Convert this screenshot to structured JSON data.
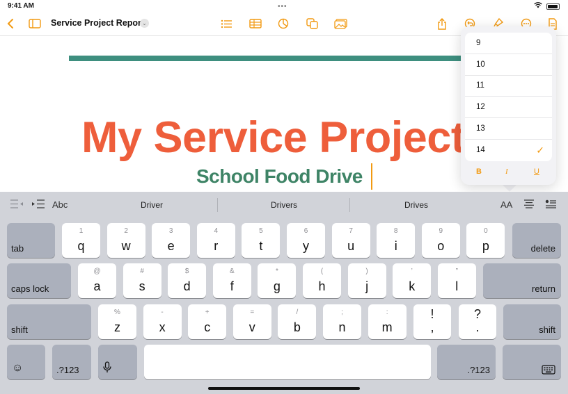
{
  "status": {
    "time": "9:41 AM",
    "dots": "•••"
  },
  "toolbar": {
    "back_icon": "chevron-left-icon",
    "title": "Service Project Report",
    "title_chevron": "⌄"
  },
  "document": {
    "heading": "My Service Project",
    "subheading": "School Food Drive"
  },
  "font_size_popover": {
    "sizes": [
      "9",
      "10",
      "11",
      "12",
      "13",
      "14"
    ],
    "selected": "14",
    "check": "✓",
    "bold": "B",
    "italic": "I",
    "underline": "U"
  },
  "keyboard": {
    "suggestions": {
      "tool_abc": "Abc",
      "word1": "Driver",
      "word2": "Drivers",
      "word3": "Drives",
      "text_size": "AA"
    },
    "row1": [
      {
        "main": "q",
        "alt": "1"
      },
      {
        "main": "w",
        "alt": "2"
      },
      {
        "main": "e",
        "alt": "3"
      },
      {
        "main": "r",
        "alt": "4"
      },
      {
        "main": "t",
        "alt": "5"
      },
      {
        "main": "y",
        "alt": "6"
      },
      {
        "main": "u",
        "alt": "7"
      },
      {
        "main": "i",
        "alt": "8"
      },
      {
        "main": "o",
        "alt": "9"
      },
      {
        "main": "p",
        "alt": "0"
      }
    ],
    "row2": [
      {
        "main": "a",
        "alt": "@"
      },
      {
        "main": "s",
        "alt": "#"
      },
      {
        "main": "d",
        "alt": "$"
      },
      {
        "main": "f",
        "alt": "&"
      },
      {
        "main": "g",
        "alt": "*"
      },
      {
        "main": "h",
        "alt": "("
      },
      {
        "main": "j",
        "alt": ")"
      },
      {
        "main": "k",
        "alt": "’"
      },
      {
        "main": "l",
        "alt": "”"
      }
    ],
    "row3": [
      {
        "main": "z",
        "alt": "%"
      },
      {
        "main": "x",
        "alt": "-"
      },
      {
        "main": "c",
        "alt": "+"
      },
      {
        "main": "v",
        "alt": "="
      },
      {
        "main": "b",
        "alt": "/"
      },
      {
        "main": "n",
        "alt": ";"
      },
      {
        "main": "m",
        "alt": ":"
      }
    ],
    "punct1": {
      "top": "!",
      "bottom": ","
    },
    "punct2": {
      "top": "?",
      "bottom": "."
    },
    "labels": {
      "tab": "tab",
      "delete": "delete",
      "caps_lock": "caps lock",
      "return": "return",
      "shift": "shift",
      "numbers": ".?123",
      "emoji": "☺",
      "mic": "🎙",
      "keyboard_hide": "⌨"
    }
  }
}
